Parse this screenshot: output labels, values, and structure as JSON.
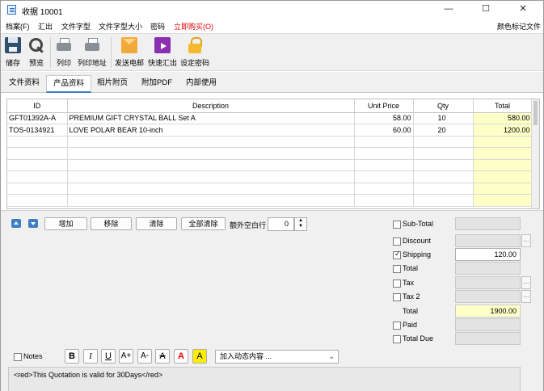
{
  "window": {
    "title": "收据 10001",
    "min_glyph": "—",
    "max_glyph": "☐",
    "close_glyph": "✕"
  },
  "menu": {
    "items": [
      "档案(F)",
      "汇出",
      "文件字型",
      "文件字型大小",
      "密码",
      "立即购买(O)"
    ],
    "right_item": "颜色标记文件",
    "accent_color": "#e00000"
  },
  "toolbar": {
    "save": "储存",
    "preview": "预览",
    "print": "列印",
    "print_address": "列印地址",
    "send_email": "发送电邮",
    "quick_export": "快速汇出",
    "set_password": "设定密码"
  },
  "tabs": [
    "文件资料",
    "产品资料",
    "相片附页",
    "附加PDF",
    "内部使用"
  ],
  "active_tab": "产品资料",
  "grid": {
    "headers": [
      "ID",
      "Description",
      "Unit Price",
      "Qty",
      "Total"
    ],
    "rows": [
      [
        "GFT01392A-A",
        "PREMIUM GIFT CRYSTAL BALL Set A",
        "58.00",
        "10",
        "580.00"
      ],
      [
        "TOS-0134921",
        "LOVE POLAR BEAR 10-inch",
        "60.00",
        "20",
        "1200.00"
      ],
      [
        "",
        "",
        "",
        "",
        ""
      ],
      [
        "",
        "",
        "",
        "",
        ""
      ],
      [
        "",
        "",
        "",
        "",
        ""
      ],
      [
        "",
        "",
        "",
        "",
        ""
      ],
      [
        "",
        "",
        "",
        "",
        ""
      ],
      [
        "",
        "",
        "",
        "",
        ""
      ]
    ]
  },
  "row_actions": {
    "add": "增加",
    "remove": "移除",
    "clear": "清除",
    "clear_all": "全部清除",
    "extra_blank_label": "额外空白行",
    "extra_blank_value": "0"
  },
  "summary": {
    "subtotal_label": "Sub-Total",
    "subtotal_value": "",
    "discount_label": "Discount",
    "discount_value": "",
    "shipping_label": "Shipping",
    "shipping_value": "120.00",
    "shipping_checked": true,
    "total1_label": "Total",
    "total1_value": "",
    "tax_label": "Tax",
    "tax_value": "",
    "tax2_label": "Tax 2",
    "tax2_value": "",
    "total_label": "Total",
    "total_value": "1900.00",
    "paid_label": "Paid",
    "paid_value": "",
    "totaldue_label": "Total Due",
    "totaldue_value": ""
  },
  "notes": {
    "label": "Notes",
    "dynamic_placeholder": "加入动态内容 ...",
    "text": "<red>This Quotation is valid for 30Days</red>"
  },
  "format_buttons": [
    "B",
    "I",
    "U",
    "A+",
    "A-",
    "A",
    "A",
    "A"
  ],
  "colors": {
    "total_highlight": "#ffffc8",
    "accent": "#3c7fc4",
    "highlight_yellow": "#ffee00"
  }
}
